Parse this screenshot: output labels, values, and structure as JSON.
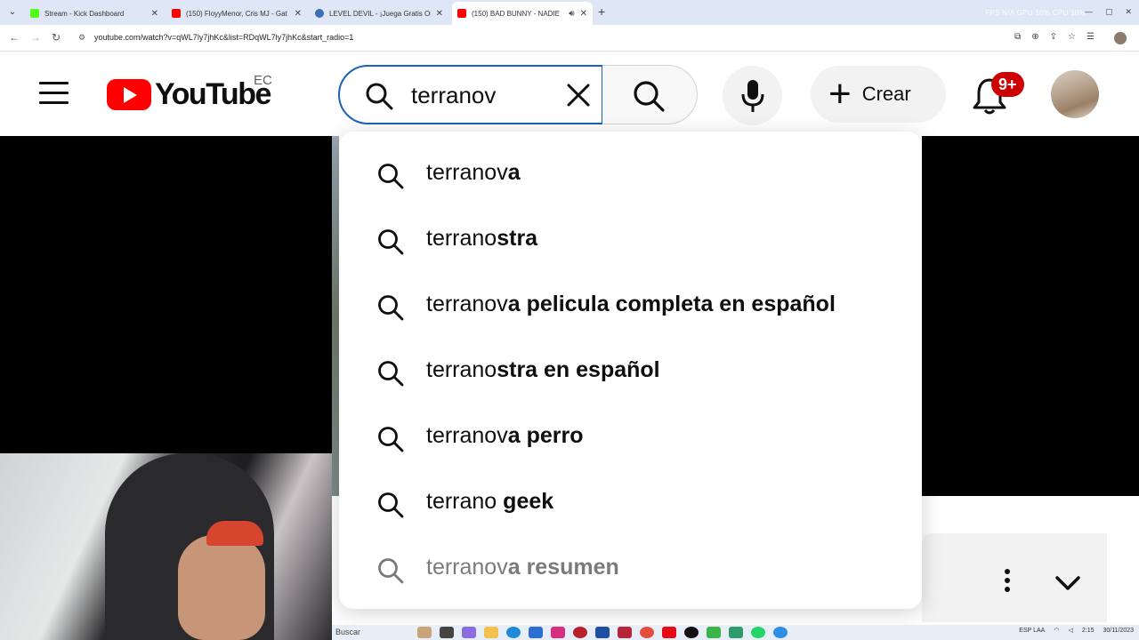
{
  "browser": {
    "tabs": [
      {
        "title": "Stream - Kick Dashboard",
        "favicon_color": "#53fc18"
      },
      {
        "title": "(150) FloyyMenor, Cris MJ - Gat",
        "favicon_color": "#ff0000"
      },
      {
        "title": "LEVEL DEVIL - ¡Juega Gratis On",
        "favicon_color": "#3b6fb6"
      },
      {
        "title": "(150) BAD BUNNY - NADIE",
        "favicon_color": "#ff0000"
      }
    ],
    "active_tab": 3,
    "url": "youtube.com/watch?v=qWL7ly7jhKc&list=RDqWL7ly7jhKc&start_radio=1",
    "overlay_stats": "FPS N/A   GPU 10%   CPU 10%"
  },
  "youtube": {
    "logo_text": "YouTube",
    "country_code": "EC",
    "search_value": "terranov",
    "create_label": "Crear",
    "notification_badge": "9+",
    "brand_color": "#ff0000",
    "accent_color": "#1c62b9"
  },
  "suggestions": [
    {
      "prefix": "terranov",
      "rest": "a"
    },
    {
      "prefix": "terrano",
      "rest": "stra"
    },
    {
      "prefix": "terranov",
      "rest": "a pelicula completa en español"
    },
    {
      "prefix": "terrano",
      "rest": "stra en español"
    },
    {
      "prefix": "terranov",
      "rest": "a perro"
    },
    {
      "prefix": "terrano ",
      "rest": "geek"
    },
    {
      "prefix": "terranov",
      "rest": "a resumen"
    }
  ],
  "taskbar": {
    "search_label": "Buscar",
    "lang": "ESP LAA",
    "time": "2:15",
    "date": "30/11/2023"
  },
  "icons": [
    "menu-icon",
    "search-icon",
    "close-icon",
    "mic-icon",
    "plus-icon",
    "bell-icon",
    "kebab-icon",
    "chevron-down-icon"
  ]
}
